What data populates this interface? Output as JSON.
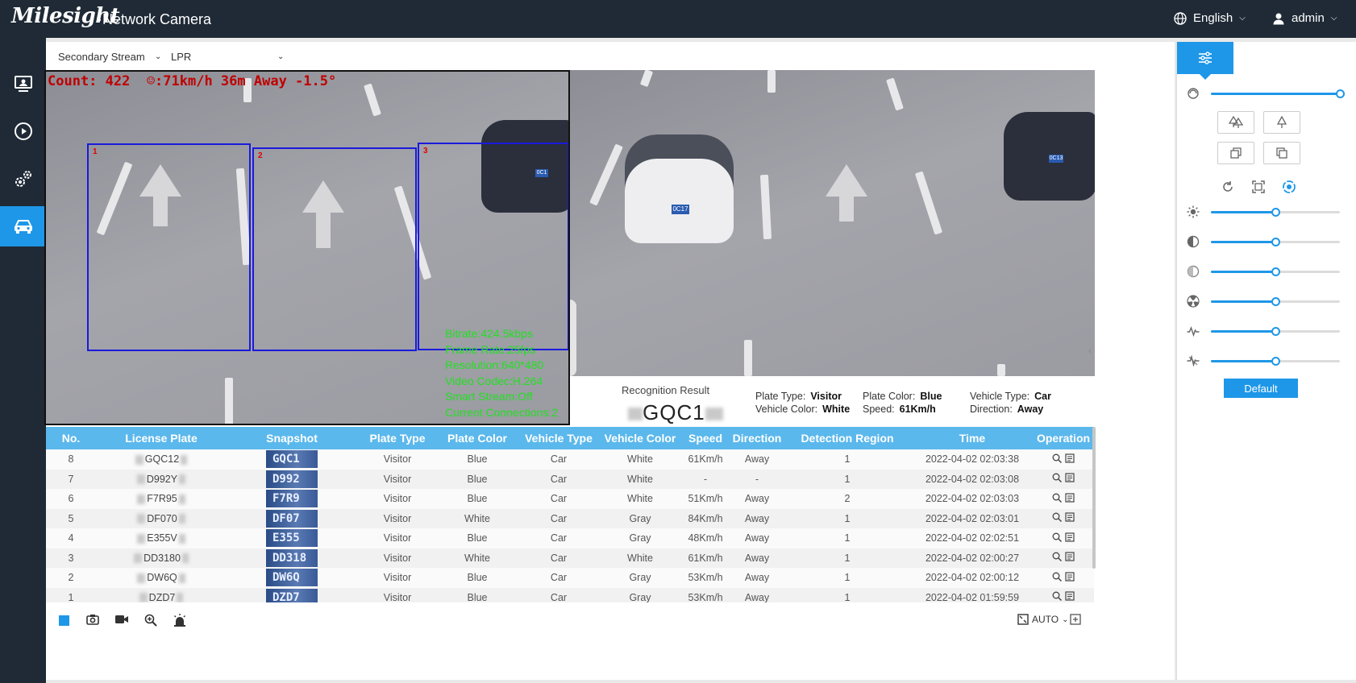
{
  "header": {
    "brand": "Milesight",
    "product": "·Network Camera",
    "language": "English",
    "user": "admin"
  },
  "sidebar": {
    "items": [
      {
        "name": "live-view",
        "icon": "monitor-icon",
        "active": false
      },
      {
        "name": "playback",
        "icon": "play-circle-icon",
        "active": false
      },
      {
        "name": "settings",
        "icon": "gears-icon",
        "active": false
      },
      {
        "name": "lpr",
        "icon": "car-icon",
        "active": true
      }
    ]
  },
  "stream": {
    "selected": "Secondary Stream",
    "mode": "LPR"
  },
  "video": {
    "osd": "Count: 422  ☺:71km/h 36m Away -1.5°",
    "regions": [
      "1",
      "2",
      "3"
    ],
    "stats": [
      "Bitrate:424.5kbps",
      "Frame Rate:25fps",
      "Resolution:640*480",
      "Video Codec:H.264",
      "Smart Stream:Off",
      "Current Connections:2"
    ],
    "plates": [
      "0C1",
      "0C17",
      "0C13"
    ]
  },
  "recognition": {
    "title": "Recognition Result",
    "plate": "GQC1",
    "plate_type_label": "Plate Type:",
    "plate_type": "Visitor",
    "plate_color_label": "Plate Color:",
    "plate_color": "Blue",
    "vehicle_type_label": "Vehicle Type:",
    "vehicle_type": "Car",
    "vehicle_color_label": "Vehicle Color:",
    "vehicle_color": "White",
    "speed_label": "Speed:",
    "speed": "61Km/h",
    "direction_label": "Direction:",
    "direction": "Away"
  },
  "table": {
    "columns": [
      "No.",
      "License Plate",
      "Snapshot",
      "Plate Type",
      "Plate Color",
      "Vehicle Type",
      "Vehicle Color",
      "Speed",
      "Direction",
      "Detection Region",
      "Time",
      "Operation"
    ],
    "rows": [
      {
        "no": "8",
        "plate": "GQC12",
        "snap": "GQC1",
        "ptype": "Visitor",
        "pcolor": "Blue",
        "vtype": "Car",
        "vcolor": "White",
        "speed": "61Km/h",
        "dir": "Away",
        "region": "1",
        "time": "2022-04-02 02:03:38"
      },
      {
        "no": "7",
        "plate": "D992Y",
        "snap": "D992",
        "ptype": "Visitor",
        "pcolor": "Blue",
        "vtype": "Car",
        "vcolor": "White",
        "speed": "-",
        "dir": "-",
        "region": "1",
        "time": "2022-04-02 02:03:08"
      },
      {
        "no": "6",
        "plate": "F7R95",
        "snap": "F7R9",
        "ptype": "Visitor",
        "pcolor": "Blue",
        "vtype": "Car",
        "vcolor": "White",
        "speed": "51Km/h",
        "dir": "Away",
        "region": "2",
        "time": "2022-04-02 02:03:03"
      },
      {
        "no": "5",
        "plate": "DF070",
        "snap": "DF07",
        "ptype": "Visitor",
        "pcolor": "White",
        "vtype": "Car",
        "vcolor": "Gray",
        "speed": "84Km/h",
        "dir": "Away",
        "region": "1",
        "time": "2022-04-02 02:03:01"
      },
      {
        "no": "4",
        "plate": "E355V",
        "snap": "E355",
        "ptype": "Visitor",
        "pcolor": "Blue",
        "vtype": "Car",
        "vcolor": "Gray",
        "speed": "48Km/h",
        "dir": "Away",
        "region": "1",
        "time": "2022-04-02 02:02:51"
      },
      {
        "no": "3",
        "plate": "DD3180",
        "snap": "DD318",
        "ptype": "Visitor",
        "pcolor": "White",
        "vtype": "Car",
        "vcolor": "White",
        "speed": "61Km/h",
        "dir": "Away",
        "region": "1",
        "time": "2022-04-02 02:00:27"
      },
      {
        "no": "2",
        "plate": "DW6Q",
        "snap": "DW6Q",
        "ptype": "Visitor",
        "pcolor": "Blue",
        "vtype": "Car",
        "vcolor": "Gray",
        "speed": "53Km/h",
        "dir": "Away",
        "region": "1",
        "time": "2022-04-02 02:00:12"
      },
      {
        "no": "1",
        "plate": "DZD7",
        "snap": "DZD7",
        "ptype": "Visitor",
        "pcolor": "Blue",
        "vtype": "Car",
        "vcolor": "Gray",
        "speed": "53Km/h",
        "dir": "Away",
        "region": "1",
        "time": "2022-04-02 01:59:59"
      }
    ]
  },
  "bottom_toolbar": {
    "zoom_mode": "AUTO"
  },
  "image_panel": {
    "sliders": [
      {
        "name": "ir-level",
        "icon": "ir-icon",
        "value": 1.0
      },
      {
        "name": "brightness",
        "icon": "sun-icon",
        "value": 0.5
      },
      {
        "name": "contrast",
        "icon": "contrast-icon",
        "value": 0.5
      },
      {
        "name": "saturation",
        "icon": "saturation-icon",
        "value": 0.5
      },
      {
        "name": "sharpness",
        "icon": "radiation-icon",
        "value": 0.5
      },
      {
        "name": "noise-reduction",
        "icon": "pulse-icon",
        "value": 0.5
      },
      {
        "name": "noise-filter",
        "icon": "spark-icon",
        "value": 0.5
      }
    ],
    "default_label": "Default"
  },
  "colors": {
    "header_bg": "#1f2a36",
    "accent": "#1e97e8",
    "table_header": "#5bb8ec",
    "osd_red": "#c00000",
    "stats_green": "#22e022",
    "region_blue": "#1a1adc"
  }
}
